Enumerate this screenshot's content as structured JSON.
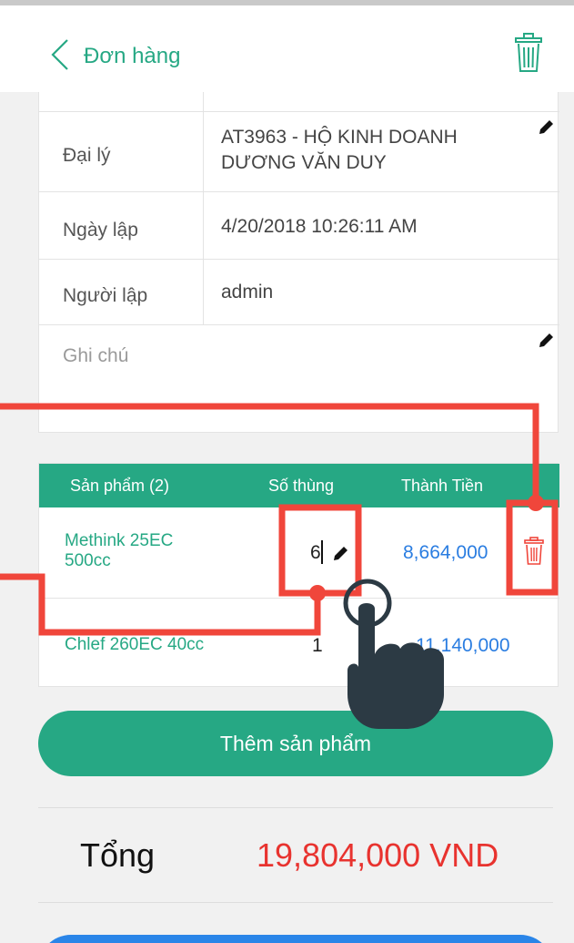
{
  "header": {
    "title": "Đơn hàng",
    "back_icon": "chevron-left-icon",
    "delete_icon": "trash-icon"
  },
  "order_info": {
    "agent_label": "Đại lý",
    "agent_value_line1": "AT3963 - HỘ KINH DOANH",
    "agent_value_line2": "DƯƠNG VĂN DUY",
    "date_label": "Ngày lập",
    "date_value": "4/20/2018 10:26:11 AM",
    "creator_label": "Người lập",
    "creator_value": "admin",
    "note_placeholder": "Ghi chú"
  },
  "products_table": {
    "headers": [
      "Sản phẩm (2)",
      "Số thùng",
      "Thành Tiền"
    ],
    "rows": [
      {
        "name_line1": "Methink 25EC",
        "name_line2": "500cc",
        "qty": "6",
        "amount": "8,664,000"
      },
      {
        "name_line1": "Chlef 260EC 40cc",
        "name_line2": "",
        "qty": "1",
        "amount": "11,140,000"
      }
    ]
  },
  "add_product_label": "Thêm sản phẩm",
  "total": {
    "label": "Tổng",
    "value": "19,804,000 VND"
  },
  "colors": {
    "accent": "#26a884",
    "amount": "#2a7de1",
    "total": "#e8332f",
    "annotation": "#f0463b"
  }
}
